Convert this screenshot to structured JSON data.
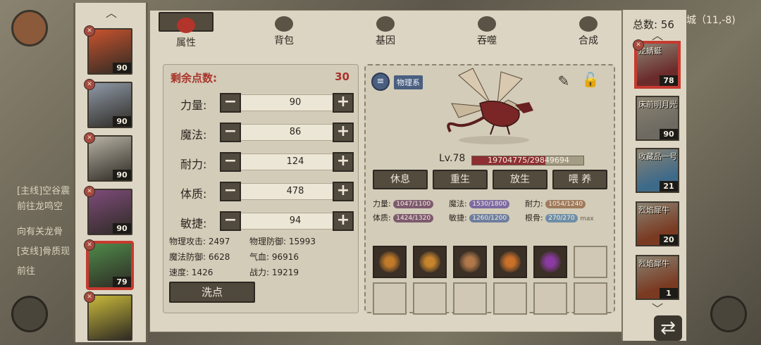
{
  "background": {
    "quest_lines": [
      {
        "tag": "[主线]",
        "text": "空谷震"
      },
      {
        "tag": "",
        "text": "前往龙鸣空"
      },
      {
        "tag": "",
        "text": "向有关龙骨"
      },
      {
        "tag": "[支线]",
        "text": "骨质现"
      },
      {
        "tag": "",
        "text": "前往"
      }
    ],
    "location": "城（11,-8)"
  },
  "roster": {
    "items": [
      {
        "level": "90",
        "color": "#c9532e",
        "selected": false
      },
      {
        "level": "90",
        "color": "#8f9aa8",
        "selected": false
      },
      {
        "level": "90",
        "color": "#b7b2a4",
        "selected": false
      },
      {
        "level": "90",
        "color": "#7e4c7a",
        "selected": false
      },
      {
        "level": "79",
        "color": "#4f8a4a",
        "selected": true
      },
      {
        "level": "",
        "color": "#c9b93a",
        "selected": false
      }
    ]
  },
  "tabs": [
    {
      "label": "属性",
      "active": true
    },
    {
      "label": "背包",
      "active": false
    },
    {
      "label": "基因",
      "active": false
    },
    {
      "label": "吞噬",
      "active": false
    },
    {
      "label": "合成",
      "active": false
    }
  ],
  "points": {
    "label": "剩余点数:",
    "value": "30"
  },
  "stats": [
    {
      "label": "力量:",
      "value": "90"
    },
    {
      "label": "魔法:",
      "value": "86"
    },
    {
      "label": "耐力:",
      "value": "124"
    },
    {
      "label": "体质:",
      "value": "478"
    },
    {
      "label": "敏捷:",
      "value": "94"
    }
  ],
  "attributes": {
    "phys_atk": "物理攻击: 2497",
    "phys_def": "物理防御: 15993",
    "mag_def": "魔法防御: 6628",
    "hp": "气血: 96916",
    "speed": "速度: 1426",
    "power": "战力: 19219"
  },
  "wash_button": "洗点",
  "pet": {
    "tag": "物理系",
    "level": "Lv.78",
    "exp_text": "19704775/29849694",
    "exp_fraction": 0.66,
    "actions": [
      "休息",
      "重生",
      "放生",
      "喂 养"
    ],
    "aptitudes": [
      {
        "label": "力量:",
        "value": "1047/1100",
        "color": "#7e5a6e"
      },
      {
        "label": "魔法:",
        "value": "1530/1800",
        "color": "#7c6aa0"
      },
      {
        "label": "耐力:",
        "value": "1054/1240",
        "color": "#a07a5c"
      },
      {
        "label": "体质:",
        "value": "1424/1320",
        "color": "#7e5a6e"
      },
      {
        "label": "敏捷:",
        "value": "1260/1200",
        "color": "#6e7e9e"
      },
      {
        "label": "根骨:",
        "value": "270/270",
        "color": "#6e8ea6",
        "suffix": "max"
      }
    ],
    "skills": [
      {
        "name": "claw-skill",
        "filled": true
      },
      {
        "name": "sun-skill",
        "filled": true
      },
      {
        "name": "swirl-skill",
        "filled": true
      },
      {
        "name": "flame-skill",
        "filled": true
      },
      {
        "name": "orb-skill",
        "filled": true
      },
      {
        "name": "empty",
        "filled": false
      },
      {
        "name": "empty",
        "filled": false
      },
      {
        "name": "empty",
        "filled": false
      },
      {
        "name": "empty",
        "filled": false
      },
      {
        "name": "empty",
        "filled": false
      },
      {
        "name": "empty",
        "filled": false
      },
      {
        "name": "empty",
        "filled": false
      }
    ]
  },
  "pets_sidebar": {
    "total_label": "总数: 56",
    "items": [
      {
        "name": "龙蜻蜓",
        "level": "78",
        "selected": true,
        "color": "#6b2b2b"
      },
      {
        "name": "床前明月光",
        "level": "90",
        "selected": false,
        "color": "#6e6a62"
      },
      {
        "name": "收藏品一号",
        "level": "21",
        "selected": false,
        "color": "#3e6a8a"
      },
      {
        "name": "烈焰犀牛",
        "level": "20",
        "selected": false,
        "color": "#7a3a22"
      },
      {
        "name": "烈焰犀牛",
        "level": "1",
        "selected": false,
        "color": "#7a3a22"
      }
    ]
  }
}
